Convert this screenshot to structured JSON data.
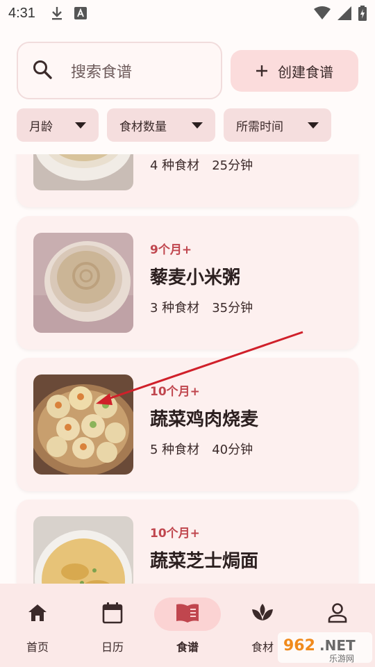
{
  "status_bar": {
    "time": "4:31",
    "left_icons": [
      "download-icon",
      "app-a-icon"
    ],
    "right_icons": [
      "wifi-icon",
      "signal-icon",
      "battery-charging-icon"
    ]
  },
  "search": {
    "placeholder": "搜索食谱"
  },
  "create_button": {
    "label": "创建食谱"
  },
  "filters": [
    {
      "label": "月龄"
    },
    {
      "label": "食材数量"
    },
    {
      "label": "所需时间"
    }
  ],
  "recipes": [
    {
      "age": "",
      "title": "",
      "ingredients": "4 种食材",
      "time": "25分钟",
      "image": "porridge-bowl"
    },
    {
      "age": "9个月+",
      "title": "藜麦小米粥",
      "ingredients": "3 种食材",
      "time": "35分钟",
      "image": "quinoa-millet-porridge"
    },
    {
      "age": "10个月+",
      "title": "蔬菜鸡肉烧麦",
      "ingredients": "5 种食材",
      "time": "40分钟",
      "image": "shaomai-steamer"
    },
    {
      "age": "10个月+",
      "title": "蔬菜芝士焗面",
      "ingredients": "",
      "time": "",
      "image": "cheese-baked-pasta"
    }
  ],
  "bottom_nav": [
    {
      "label": "首页",
      "icon": "home-icon",
      "active": false
    },
    {
      "label": "日历",
      "icon": "calendar-icon",
      "active": false
    },
    {
      "label": "食谱",
      "icon": "recipe-book-icon",
      "active": true
    },
    {
      "label": "食材",
      "icon": "leaf-icon",
      "active": false
    },
    {
      "label": "",
      "icon": "person-icon",
      "active": false
    }
  ],
  "colors": {
    "accent": "#c0464e",
    "card_bg": "#fdf0ef",
    "filter_bg": "#f5dede",
    "create_bg": "#fbdcdc",
    "annotation_arrow": "#d0202a"
  },
  "watermark": {
    "text": "962.NET",
    "subtext": "乐游网"
  }
}
